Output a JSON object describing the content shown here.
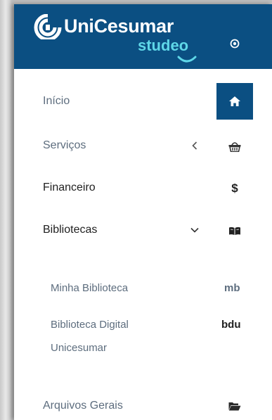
{
  "brand": {
    "name": "UniCesumar",
    "sub": "studeo"
  },
  "colors": {
    "brand_blue": "#0b4f82",
    "accent_cyan": "#5fd7e8",
    "muted_text": "#5d6d7e"
  },
  "header": {
    "settings_icon": "circle-dot-icon"
  },
  "menu": {
    "inicio": {
      "label": "Início",
      "icon": "home-icon",
      "active": true
    },
    "servicos": {
      "label": "Serviços",
      "icon": "basket-icon",
      "expander": "chevron-left"
    },
    "financeiro": {
      "label": "Financeiro",
      "icon_text": "$"
    },
    "bibliotecas": {
      "label": "Bibliotecas",
      "icon": "book-open-icon",
      "expander": "chevron-down",
      "children": [
        {
          "label": "Minha Biblioteca",
          "abbr": "mb"
        },
        {
          "label_line1": "Biblioteca Digital",
          "label_line2": "Unicesumar",
          "abbr": "bdu"
        }
      ]
    },
    "arquivos": {
      "label": "Arquivos Gerais",
      "icon": "folder-open-icon"
    }
  }
}
